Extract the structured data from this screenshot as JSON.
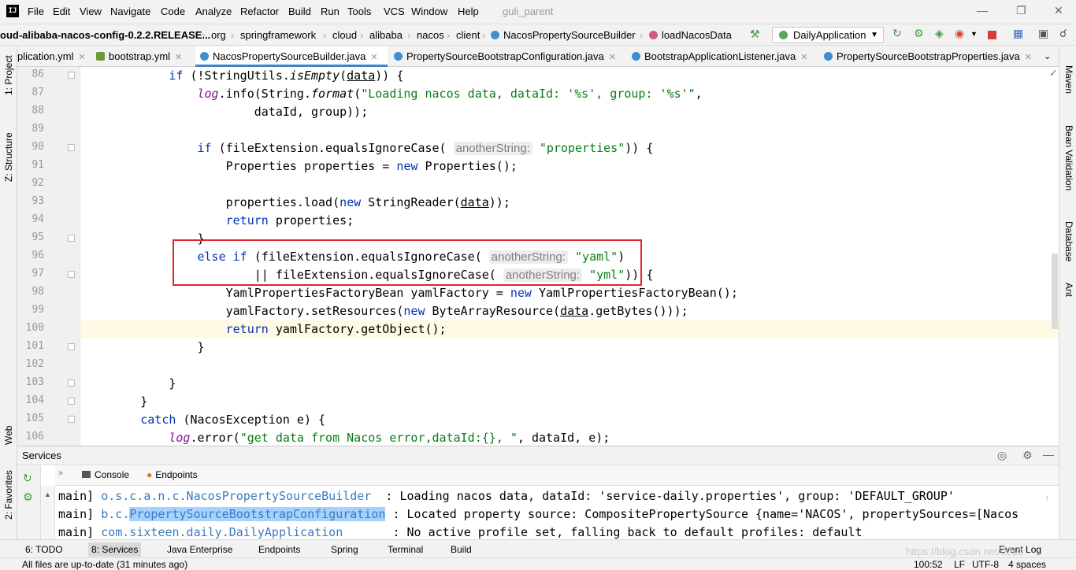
{
  "menubar": {
    "items": [
      "File",
      "Edit",
      "View",
      "Navigate",
      "Code",
      "Analyze",
      "Refactor",
      "Build",
      "Run",
      "Tools",
      "VCS",
      "Window",
      "Help"
    ],
    "project_title": "guli_parent"
  },
  "navbar": {
    "crumbs": [
      "oud-alibaba-nacos-config-0.2.2.RELEASE...",
      "org",
      "springframework",
      "cloud",
      "alibaba",
      "nacos",
      "client",
      "NacosPropertySourceBuilder",
      "loadNacosData"
    ],
    "run_config": "DailyApplication"
  },
  "tabs": [
    {
      "label": "plication.yml",
      "color": "#8a6d3b"
    },
    {
      "label": "bootstrap.yml",
      "color": "#6a9b3b"
    },
    {
      "label": "NacosPropertySourceBuilder.java",
      "color": "#3d8fd1",
      "active": true
    },
    {
      "label": "PropertySourceBootstrapConfiguration.java",
      "color": "#3d8fd1"
    },
    {
      "label": "BootstrapApplicationListener.java",
      "color": "#3d8fd1"
    },
    {
      "label": "PropertySourceBootstrapProperties.java",
      "color": "#3d8fd1"
    }
  ],
  "left_tools": [
    "1: Project",
    "Z: Structure",
    "Web",
    "2: Favorites"
  ],
  "right_tools": [
    "Maven",
    "Bean Validation",
    "Database",
    "Ant"
  ],
  "editor": {
    "line_numbers": [
      "86",
      "87",
      "88",
      "89",
      "90",
      "91",
      "92",
      "93",
      "94",
      "95",
      "96",
      "97",
      "98",
      "99",
      "100",
      "101",
      "102",
      "103",
      "104",
      "105",
      "106"
    ]
  },
  "services": {
    "title": "Services",
    "tabs": [
      "Console",
      "Endpoints"
    ],
    "log": [
      {
        "thread": "main]",
        "logger": "o.s.c.a.n.c.NacosPropertySourceBuilder",
        "msg": "  : Loading nacos data, dataId: 'service-daily.properties', group: 'DEFAULT_GROUP'"
      },
      {
        "thread": "main]",
        "logger": "b.c.PropertySourceBootstrapConfiguration",
        "msg": " : Located property source: CompositePropertySource {name='NACOS', propertySources=[Nacos"
      },
      {
        "thread": "main]",
        "logger": "com.sixteen.daily.DailyApplication",
        "msg": "       : No active profile set, falling back to default profiles: default"
      }
    ]
  },
  "bottom_tabs": [
    "6: TODO",
    "8: Services",
    "Java Enterprise",
    "Endpoints",
    "Spring",
    "Terminal",
    "Build",
    "Event Log"
  ],
  "status": {
    "message": "All files are up-to-date (31 minutes ago)",
    "position": "100:52",
    "line_sep": "LF",
    "encoding": "UTF-8",
    "indent": "4 spaces"
  },
  "watermark": "https://blog.csdn.net/u010"
}
